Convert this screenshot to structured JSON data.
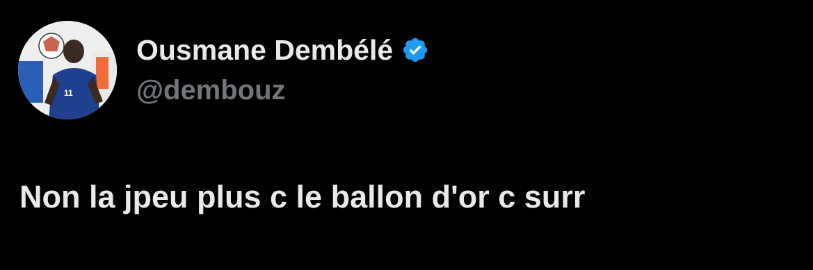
{
  "author": {
    "display_name": "Ousmane Dembélé",
    "handle": "@dembouz",
    "verified": true,
    "avatar_icon": "player-photo-avatar"
  },
  "tweet": {
    "text": "Non la jpeu plus c le ballon d'or c surr"
  },
  "colors": {
    "background": "#000000",
    "name": "#e7e9ea",
    "handle": "#71767b",
    "verified_badge": "#1d9bf0"
  }
}
